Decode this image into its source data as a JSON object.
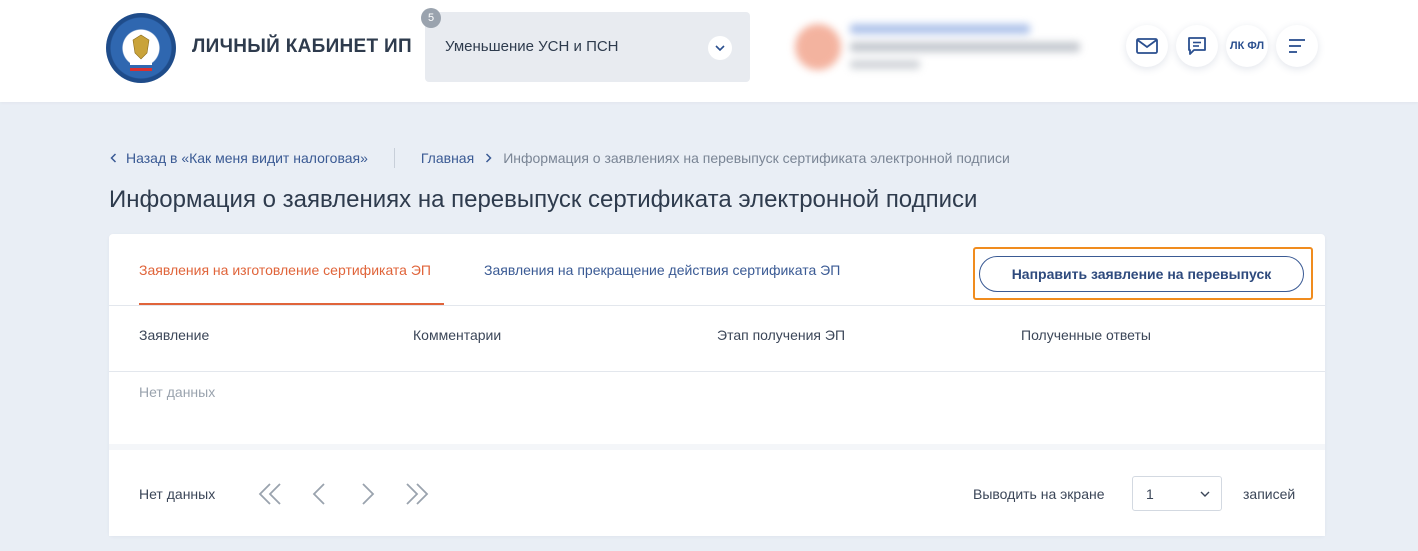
{
  "header": {
    "brand_title": "ЛИЧНЫЙ КАБИНЕТ ИП",
    "service": {
      "badge": "5",
      "selected": "Уменьшение УСН и ПСН"
    },
    "actions": {
      "lk_fl_label": "ЛК ФЛ"
    }
  },
  "breadcrumbs": {
    "back": "Назад в «Как меня видит налоговая»",
    "home": "Главная",
    "current": "Информация о заявлениях на перевыпуск сертификата электронной подписи"
  },
  "page": {
    "title": "Информация о заявлениях на перевыпуск сертификата электронной подписи"
  },
  "tabs": [
    {
      "label": "Заявления на изготовление сертификата ЭП",
      "active": true
    },
    {
      "label": "Заявления на прекращение действия сертификата ЭП",
      "active": false
    }
  ],
  "reissue_button": "Направить заявление на перевыпуск",
  "table": {
    "columns": [
      "Заявление",
      "Комментарии",
      "Этап получения ЭП",
      "Полученные ответы"
    ],
    "empty": "Нет данных"
  },
  "pagination": {
    "status": "Нет данных",
    "per_page_label": "Выводить на экране",
    "per_page_value": "1",
    "records_label": "записей"
  },
  "colors": {
    "accent": "#e0643a",
    "link": "#3a5a94",
    "highlight": "#f08c1e"
  }
}
